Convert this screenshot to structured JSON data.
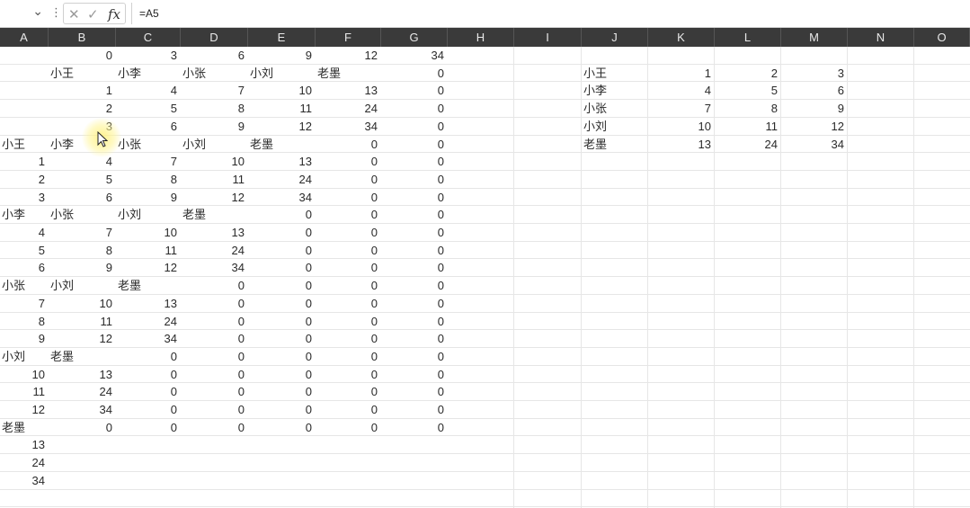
{
  "formula_bar": {
    "name_box": "",
    "chevron": "⌄",
    "separator": "⋮",
    "cancel_glyph": "✕",
    "enter_glyph": "✓",
    "fx_label": "fx",
    "formula": "=A5"
  },
  "columns": [
    "A",
    "B",
    "C",
    "D",
    "E",
    "F",
    "G",
    "H",
    "I",
    "J",
    "K",
    "L",
    "M",
    "N",
    "O"
  ],
  "grid_rows": [
    [
      "",
      "0",
      "3",
      "6",
      "9",
      "12",
      "34"
    ],
    [
      "",
      "小王",
      "小李",
      "小张",
      "小刘",
      "老墨",
      "0"
    ],
    [
      "",
      "1",
      "4",
      "7",
      "10",
      "13",
      "0"
    ],
    [
      "",
      "2",
      "5",
      "8",
      "11",
      "24",
      "0"
    ],
    [
      "",
      "3",
      "6",
      "9",
      "12",
      "34",
      "0"
    ],
    [
      "小王",
      "小李",
      "小张",
      "小刘",
      "老墨",
      "0",
      "0"
    ],
    [
      "1",
      "4",
      "7",
      "10",
      "13",
      "0",
      "0"
    ],
    [
      "2",
      "5",
      "8",
      "11",
      "24",
      "0",
      "0"
    ],
    [
      "3",
      "6",
      "9",
      "12",
      "34",
      "0",
      "0"
    ],
    [
      "小李",
      "小张",
      "小刘",
      "老墨",
      "0",
      "0",
      "0"
    ],
    [
      "4",
      "7",
      "10",
      "13",
      "0",
      "0",
      "0"
    ],
    [
      "5",
      "8",
      "11",
      "24",
      "0",
      "0",
      "0"
    ],
    [
      "6",
      "9",
      "12",
      "34",
      "0",
      "0",
      "0"
    ],
    [
      "小张",
      "小刘",
      "老墨",
      "0",
      "0",
      "0",
      "0"
    ],
    [
      "7",
      "10",
      "13",
      "0",
      "0",
      "0",
      "0"
    ],
    [
      "8",
      "11",
      "24",
      "0",
      "0",
      "0",
      "0"
    ],
    [
      "9",
      "12",
      "34",
      "0",
      "0",
      "0",
      "0"
    ],
    [
      "小刘",
      "老墨",
      "0",
      "0",
      "0",
      "0",
      "0"
    ],
    [
      "10",
      "13",
      "0",
      "0",
      "0",
      "0",
      "0"
    ],
    [
      "11",
      "24",
      "0",
      "0",
      "0",
      "0",
      "0"
    ],
    [
      "12",
      "34",
      "0",
      "0",
      "0",
      "0",
      "0"
    ],
    [
      "老墨",
      "0",
      "0",
      "0",
      "0",
      "0",
      "0"
    ],
    [
      "13",
      "",
      "",
      "",
      "",
      "",
      ""
    ],
    [
      "24",
      "",
      "",
      "",
      "",
      "",
      ""
    ],
    [
      "34",
      "",
      "",
      "",
      "",
      "",
      ""
    ]
  ],
  "side_table": [
    [
      "小王",
      "1",
      "2",
      "3"
    ],
    [
      "小李",
      "4",
      "5",
      "6"
    ],
    [
      "小张",
      "7",
      "8",
      "9"
    ],
    [
      "小刘",
      "10",
      "11",
      "12"
    ],
    [
      "老墨",
      "13",
      "24",
      "34"
    ]
  ]
}
